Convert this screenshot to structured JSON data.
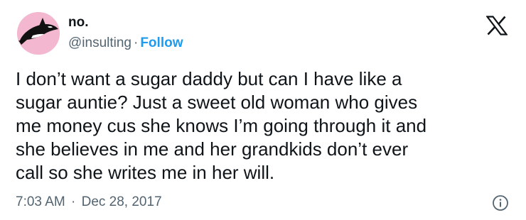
{
  "user": {
    "display_name": "no.",
    "handle": "@insulting",
    "separator": "·",
    "follow_label": "Follow",
    "avatar_icon": "orca-avatar-icon"
  },
  "platform_icon": "x-logo-icon",
  "tweet": {
    "text": "I don’t want a sugar daddy but can I have like a\nsugar auntie? Just a sweet old woman who gives\nme money cus she knows I’m going through it and\nshe believes in me and her grandkids don’t ever\ncall so she writes me in her will."
  },
  "meta": {
    "time": "7:03 AM",
    "separator": "·",
    "date": "Dec 28, 2017",
    "info_icon": "info-icon"
  },
  "colors": {
    "link_blue": "#1d9bf0",
    "secondary_text": "#536471",
    "primary_text": "#0f1419",
    "avatar_background": "#f4b7d0"
  }
}
